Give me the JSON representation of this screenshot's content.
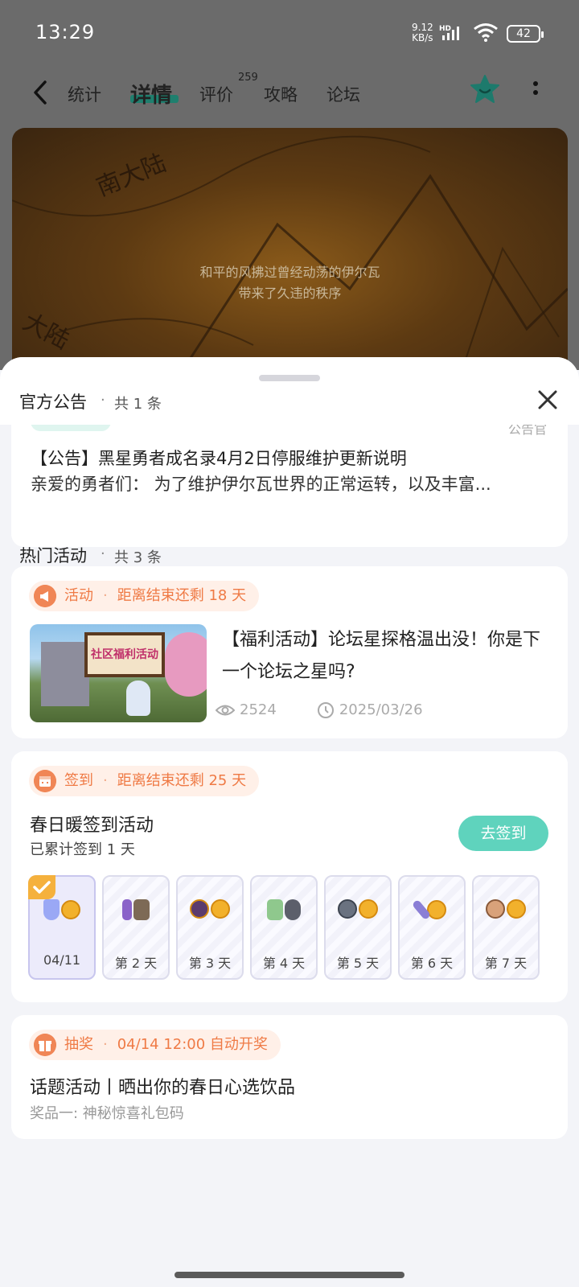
{
  "status": {
    "time": "13:29",
    "speed_top": "9.12",
    "speed_bottom": "KB/s",
    "network": "HD",
    "battery": "42"
  },
  "nav": {
    "tabs": [
      "统计",
      "详情",
      "评价",
      "攻略",
      "论坛"
    ],
    "active_tab": "详情",
    "review_badge": "259"
  },
  "banner": {
    "map_label_1": "南大陆",
    "map_label_2": "大陆",
    "subtitle_1": "和平的风拂过曾经动荡的伊尔瓦",
    "subtitle_2": "带来了久违的秩序"
  },
  "announcements": {
    "title": "官方公告",
    "separator": "·",
    "count": "共 1 条",
    "peek_right": "公告官",
    "item_title": "【公告】黑星勇者成名录4月2日停服维护更新说明",
    "item_desc": "亲爱的勇者们： 为了维护伊尔瓦世界的正常运转，以及丰富..."
  },
  "hot": {
    "title": "热门活动",
    "separator": "·",
    "count": "共 3 条"
  },
  "activity": {
    "tag": "活动",
    "remain": "距离结束还剩 18 天",
    "image_text": "社区福利活动",
    "title": "【福利活动】论坛星探格温出没！你是下一个论坛之星吗?",
    "views": "2524",
    "date": "2025/03/26"
  },
  "signin": {
    "tag": "签到",
    "remain": "距离结束还剩 25 天",
    "title": "春日暖签到活动",
    "sub": "已累计签到 1 天",
    "button": "去签到",
    "days": [
      "04/11",
      "第 2 天",
      "第 3 天",
      "第 4 天",
      "第 5 天",
      "第 6 天",
      "第 7 天"
    ]
  },
  "lottery": {
    "tag": "抽奖",
    "remain": "04/14 12:00 自动开奖",
    "title": "话题活动丨晒出你的春日心选饮品",
    "sub": "奖品一: 神秘惊喜礼包码"
  },
  "colors": {
    "accent": "#5fd3bd",
    "tag_orange": "#ef7a45",
    "tab_underline": "#1f7f6e"
  }
}
